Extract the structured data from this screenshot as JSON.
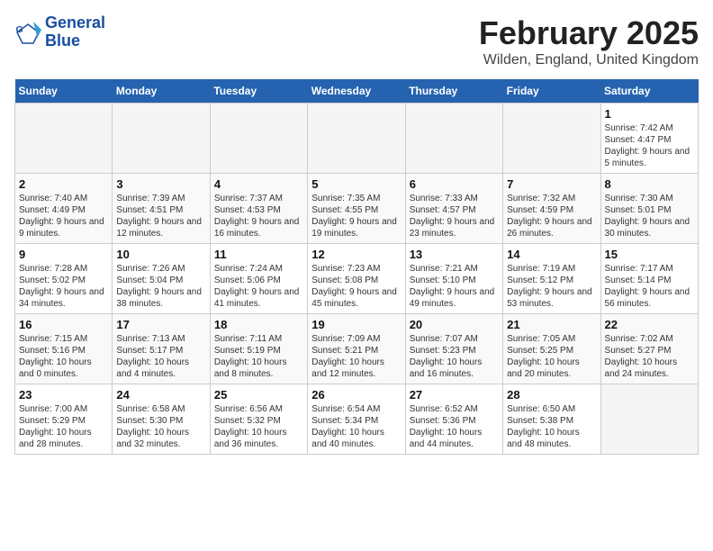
{
  "header": {
    "logo_line1": "General",
    "logo_line2": "Blue",
    "title": "February 2025",
    "subtitle": "Wilden, England, United Kingdom"
  },
  "days_of_week": [
    "Sunday",
    "Monday",
    "Tuesday",
    "Wednesday",
    "Thursday",
    "Friday",
    "Saturday"
  ],
  "weeks": [
    [
      {
        "day": "",
        "info": ""
      },
      {
        "day": "",
        "info": ""
      },
      {
        "day": "",
        "info": ""
      },
      {
        "day": "",
        "info": ""
      },
      {
        "day": "",
        "info": ""
      },
      {
        "day": "",
        "info": ""
      },
      {
        "day": "1",
        "info": "Sunrise: 7:42 AM\nSunset: 4:47 PM\nDaylight: 9 hours and 5 minutes."
      }
    ],
    [
      {
        "day": "2",
        "info": "Sunrise: 7:40 AM\nSunset: 4:49 PM\nDaylight: 9 hours and 9 minutes."
      },
      {
        "day": "3",
        "info": "Sunrise: 7:39 AM\nSunset: 4:51 PM\nDaylight: 9 hours and 12 minutes."
      },
      {
        "day": "4",
        "info": "Sunrise: 7:37 AM\nSunset: 4:53 PM\nDaylight: 9 hours and 16 minutes."
      },
      {
        "day": "5",
        "info": "Sunrise: 7:35 AM\nSunset: 4:55 PM\nDaylight: 9 hours and 19 minutes."
      },
      {
        "day": "6",
        "info": "Sunrise: 7:33 AM\nSunset: 4:57 PM\nDaylight: 9 hours and 23 minutes."
      },
      {
        "day": "7",
        "info": "Sunrise: 7:32 AM\nSunset: 4:59 PM\nDaylight: 9 hours and 26 minutes."
      },
      {
        "day": "8",
        "info": "Sunrise: 7:30 AM\nSunset: 5:01 PM\nDaylight: 9 hours and 30 minutes."
      }
    ],
    [
      {
        "day": "9",
        "info": "Sunrise: 7:28 AM\nSunset: 5:02 PM\nDaylight: 9 hours and 34 minutes."
      },
      {
        "day": "10",
        "info": "Sunrise: 7:26 AM\nSunset: 5:04 PM\nDaylight: 9 hours and 38 minutes."
      },
      {
        "day": "11",
        "info": "Sunrise: 7:24 AM\nSunset: 5:06 PM\nDaylight: 9 hours and 41 minutes."
      },
      {
        "day": "12",
        "info": "Sunrise: 7:23 AM\nSunset: 5:08 PM\nDaylight: 9 hours and 45 minutes."
      },
      {
        "day": "13",
        "info": "Sunrise: 7:21 AM\nSunset: 5:10 PM\nDaylight: 9 hours and 49 minutes."
      },
      {
        "day": "14",
        "info": "Sunrise: 7:19 AM\nSunset: 5:12 PM\nDaylight: 9 hours and 53 minutes."
      },
      {
        "day": "15",
        "info": "Sunrise: 7:17 AM\nSunset: 5:14 PM\nDaylight: 9 hours and 56 minutes."
      }
    ],
    [
      {
        "day": "16",
        "info": "Sunrise: 7:15 AM\nSunset: 5:16 PM\nDaylight: 10 hours and 0 minutes."
      },
      {
        "day": "17",
        "info": "Sunrise: 7:13 AM\nSunset: 5:17 PM\nDaylight: 10 hours and 4 minutes."
      },
      {
        "day": "18",
        "info": "Sunrise: 7:11 AM\nSunset: 5:19 PM\nDaylight: 10 hours and 8 minutes."
      },
      {
        "day": "19",
        "info": "Sunrise: 7:09 AM\nSunset: 5:21 PM\nDaylight: 10 hours and 12 minutes."
      },
      {
        "day": "20",
        "info": "Sunrise: 7:07 AM\nSunset: 5:23 PM\nDaylight: 10 hours and 16 minutes."
      },
      {
        "day": "21",
        "info": "Sunrise: 7:05 AM\nSunset: 5:25 PM\nDaylight: 10 hours and 20 minutes."
      },
      {
        "day": "22",
        "info": "Sunrise: 7:02 AM\nSunset: 5:27 PM\nDaylight: 10 hours and 24 minutes."
      }
    ],
    [
      {
        "day": "23",
        "info": "Sunrise: 7:00 AM\nSunset: 5:29 PM\nDaylight: 10 hours and 28 minutes."
      },
      {
        "day": "24",
        "info": "Sunrise: 6:58 AM\nSunset: 5:30 PM\nDaylight: 10 hours and 32 minutes."
      },
      {
        "day": "25",
        "info": "Sunrise: 6:56 AM\nSunset: 5:32 PM\nDaylight: 10 hours and 36 minutes."
      },
      {
        "day": "26",
        "info": "Sunrise: 6:54 AM\nSunset: 5:34 PM\nDaylight: 10 hours and 40 minutes."
      },
      {
        "day": "27",
        "info": "Sunrise: 6:52 AM\nSunset: 5:36 PM\nDaylight: 10 hours and 44 minutes."
      },
      {
        "day": "28",
        "info": "Sunrise: 6:50 AM\nSunset: 5:38 PM\nDaylight: 10 hours and 48 minutes."
      },
      {
        "day": "",
        "info": ""
      }
    ]
  ]
}
